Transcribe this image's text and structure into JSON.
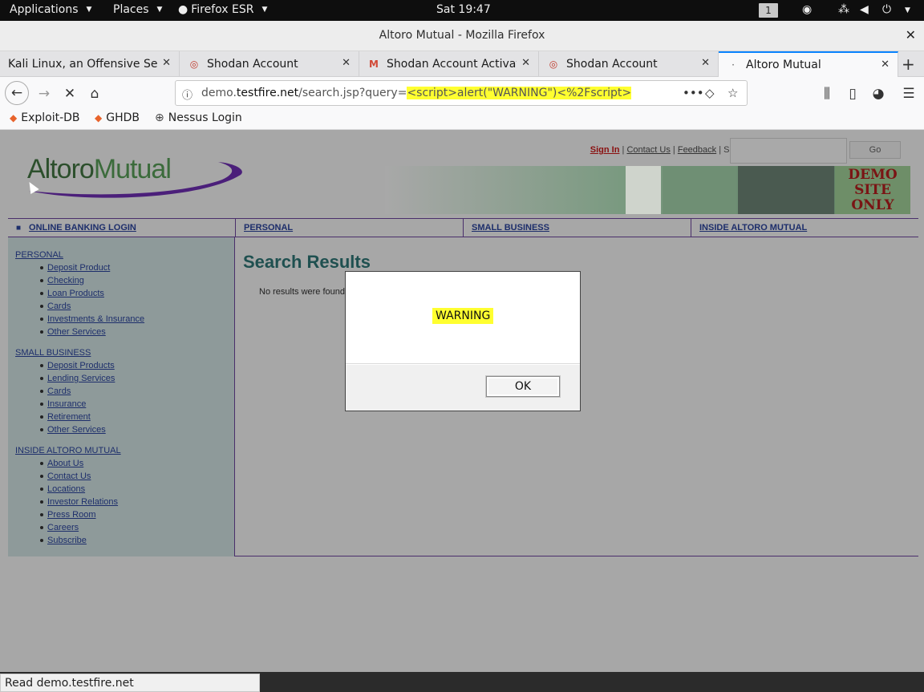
{
  "topbar": {
    "applications": "Applications",
    "places": "Places",
    "firefox": "Firefox ESR",
    "clock": "Sat 19:47",
    "workspace": "1"
  },
  "window": {
    "title": "Altoro Mutual - Mozilla Firefox"
  },
  "tabs": [
    {
      "label": "Kali Linux, an Offensive Secu",
      "icon": "kali-icon"
    },
    {
      "label": "Shodan Account",
      "icon": "shodan-icon"
    },
    {
      "label": "Shodan Account Activatio",
      "icon": "gmail-icon"
    },
    {
      "label": "Shodan Account",
      "icon": "shodan-icon"
    },
    {
      "label": "Altoro Mutual",
      "icon": "loading-icon",
      "active": true
    }
  ],
  "urlbar": {
    "prefix": "demo.",
    "domain": "testfire.net",
    "path": "/search.jsp?query=",
    "payload": "<script>alert(\"WARNING\")<%2Fscript>"
  },
  "bookmarks": [
    {
      "label": "Exploit-DB"
    },
    {
      "label": "GHDB"
    },
    {
      "label": "Nessus Login"
    }
  ],
  "site": {
    "toplinks": {
      "signin": "Sign In",
      "contact": "Contact Us",
      "feedback": "Feedback",
      "search": "Search"
    },
    "go_label": "Go",
    "logo": {
      "part1": "Altoro",
      "part2": "Mutual"
    },
    "demo": [
      "DEMO",
      "SITE",
      "ONLY"
    ],
    "nav": {
      "login": "ONLINE BANKING LOGIN",
      "personal": "PERSONAL",
      "small_business": "SMALL BUSINESS",
      "inside": "INSIDE ALTORO MUTUAL"
    },
    "sidebar": {
      "personal": {
        "title": "PERSONAL",
        "items": [
          "Deposit Product",
          "Checking",
          "Loan Products",
          "Cards",
          "Investments & Insurance",
          "Other Services"
        ]
      },
      "small_business": {
        "title": "SMALL BUSINESS",
        "items": [
          "Deposit Products",
          "Lending Services",
          "Cards",
          "Insurance",
          "Retirement",
          "Other Services"
        ]
      },
      "inside": {
        "title": "INSIDE ALTORO MUTUAL",
        "items": [
          "About Us",
          "Contact Us",
          "Locations",
          "Investor Relations",
          "Press Room",
          "Careers",
          "Subscribe"
        ]
      }
    },
    "results_title": "Search Results",
    "no_results": "No results were found f"
  },
  "dialog": {
    "message": "WARNING",
    "ok_label": "OK"
  },
  "status": {
    "text": "Read demo.testfire.net"
  },
  "colors": {
    "highlight": "#ffff30",
    "site_nav": "#1d2e6b",
    "results_title": "#1f5050"
  }
}
